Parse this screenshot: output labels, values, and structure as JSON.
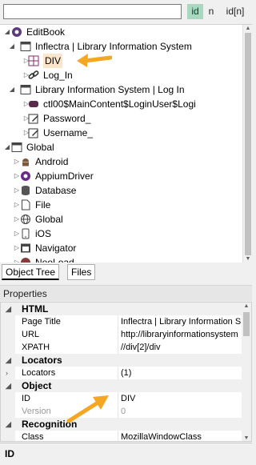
{
  "toolbar": {
    "search_value": "",
    "toggle_id": "id",
    "toggle_n": "n",
    "toggle_idn": "id[n]"
  },
  "tree": [
    {
      "label": "EditBook",
      "icon": "editbook-icon",
      "expander": "collapse"
    },
    {
      "label": "Inflectra | Library Information System",
      "icon": "browser-window-icon",
      "expander": "collapse"
    },
    {
      "label": "DIV",
      "icon": "div-element-icon",
      "expander": "expand",
      "selected": true
    },
    {
      "label": "Log_In",
      "icon": "link-icon",
      "expander": "expand"
    },
    {
      "label": "Library Information System | Log In",
      "icon": "browser-window-icon",
      "expander": "collapse"
    },
    {
      "label": "ctl00$MainContent$LoginUser$Logi",
      "icon": "button-element-icon",
      "expander": "expand"
    },
    {
      "label": "Password_",
      "icon": "edit-field-icon",
      "expander": "expand"
    },
    {
      "label": "Username_",
      "icon": "edit-field-icon",
      "expander": "expand"
    },
    {
      "label": "Global",
      "icon": "global-folder-icon",
      "expander": "collapse"
    },
    {
      "label": "Android",
      "icon": "android-icon",
      "expander": "expand"
    },
    {
      "label": "AppiumDriver",
      "icon": "appium-icon",
      "expander": "expand"
    },
    {
      "label": "Database",
      "icon": "database-icon",
      "expander": "expand"
    },
    {
      "label": "File",
      "icon": "file-icon",
      "expander": "expand"
    },
    {
      "label": "Global",
      "icon": "globe-icon",
      "expander": "expand"
    },
    {
      "label": "iOS",
      "icon": "ios-device-icon",
      "expander": "expand"
    },
    {
      "label": "Navigator",
      "icon": "navigator-icon",
      "expander": "expand"
    },
    {
      "label": "NeoLoad",
      "icon": "neoload-icon",
      "expander": "expand"
    }
  ],
  "tabs": {
    "object_tree": "Object Tree",
    "files": "Files"
  },
  "properties": {
    "title": "Properties",
    "rows": [
      {
        "kind": "cat",
        "name": "HTML",
        "exp": "collapse"
      },
      {
        "kind": "prop",
        "name": "Page Title",
        "value": "Inflectra | Library Information S"
      },
      {
        "kind": "prop",
        "name": "URL",
        "value": "http://libraryinformationsystem"
      },
      {
        "kind": "prop",
        "name": "XPATH",
        "value": "//div[2]/div"
      },
      {
        "kind": "cat",
        "name": "Locators",
        "exp": "collapse"
      },
      {
        "kind": "prop",
        "name": "Locators",
        "value": "(1)",
        "exp": "expand"
      },
      {
        "kind": "cat",
        "name": "Object",
        "exp": "collapse"
      },
      {
        "kind": "prop",
        "name": "ID",
        "value": "DIV"
      },
      {
        "kind": "prop",
        "name": "Version",
        "value": "0",
        "dim": true
      },
      {
        "kind": "cat",
        "name": "Recognition",
        "exp": "collapse"
      },
      {
        "kind": "prop",
        "name": "Class",
        "value": "MozillaWindowClass"
      }
    ],
    "description": "ID"
  },
  "colors": {
    "arrow": "#f5a623",
    "selected_bg": "#fbe6cc",
    "toggle_active": "#a8d8c0"
  }
}
